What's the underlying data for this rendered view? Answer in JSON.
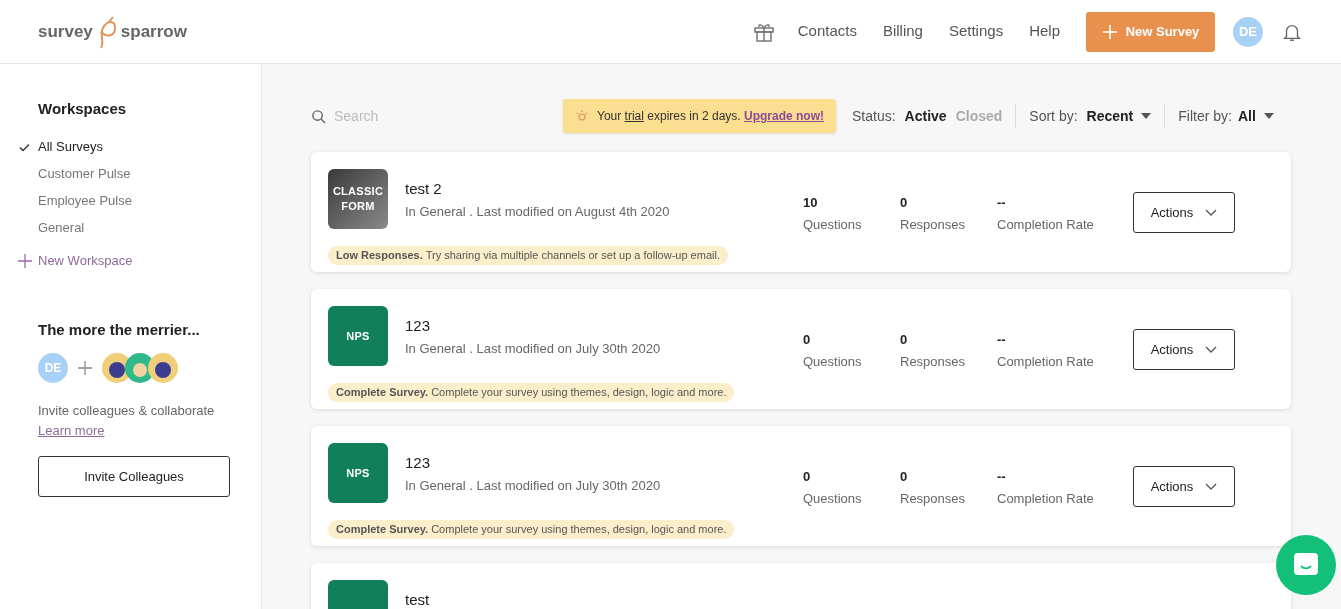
{
  "logo": {
    "left": "survey",
    "right": "sparrow"
  },
  "nav": [
    "Contacts",
    "Billing",
    "Settings",
    "Help"
  ],
  "new_survey_button": "New Survey",
  "user_avatar": "DE",
  "sidebar": {
    "title": "Workspaces",
    "items": [
      {
        "label": "All Surveys",
        "selected": true
      },
      {
        "label": "Customer Pulse",
        "selected": false
      },
      {
        "label": "Employee Pulse",
        "selected": false
      },
      {
        "label": "General",
        "selected": false
      }
    ],
    "new_workspace": "New Workspace",
    "invite": {
      "title": "The more the merrier...",
      "avatar": "DE",
      "text": "Invite colleagues & collaborate",
      "link": "Learn more",
      "button": "Invite Colleagues"
    }
  },
  "toolbar": {
    "search_placeholder": "Search",
    "trial_banner": {
      "prefix": "Your",
      "underlined": "trial",
      "suffix": "expires in 2 days.",
      "link": "Upgrade now!"
    },
    "status_label": "Status:",
    "status_options": [
      {
        "label": "Active",
        "selected": true
      },
      {
        "label": "Closed",
        "selected": false
      }
    ],
    "sort_label": "Sort by:",
    "sort_value": "Recent",
    "filter_label": "Filter by:",
    "filter_value": "All"
  },
  "surveys": [
    {
      "kind": "classic",
      "thumb": [
        "CLASSIC",
        "FORM"
      ],
      "name": "test 2",
      "meta": "In General . Last modified on August 4th 2020",
      "alert": "**Low Responses.** Try sharing via multiple channels or set up a follow-up email.",
      "stats": [
        {
          "value": "10",
          "label": "Questions"
        },
        {
          "value": "0",
          "label": "Responses"
        },
        {
          "value": "--",
          "label": "Completion Rate"
        }
      ],
      "action": "Actions"
    },
    {
      "kind": "nps",
      "thumb": [
        "NPS"
      ],
      "name": "123",
      "meta": "In General . Last modified on July 30th 2020",
      "alert": "**Complete Survey.** Complete your survey using themes, design, logic and more.",
      "stats": [
        {
          "value": "0",
          "label": "Questions"
        },
        {
          "value": "0",
          "label": "Responses"
        },
        {
          "value": "--",
          "label": "Completion Rate"
        }
      ],
      "action": "Actions"
    },
    {
      "kind": "nps",
      "thumb": [
        "NPS"
      ],
      "name": "123",
      "meta": "In General . Last modified on July 30th 2020",
      "alert": "**Complete Survey.** Complete your survey using themes, design, logic and more.",
      "stats": [
        {
          "value": "0",
          "label": "Questions"
        },
        {
          "value": "0",
          "label": "Responses"
        },
        {
          "value": "--",
          "label": "Completion Rate"
        }
      ],
      "action": "Actions"
    },
    {
      "kind": "nps",
      "name": "test"
    }
  ]
}
